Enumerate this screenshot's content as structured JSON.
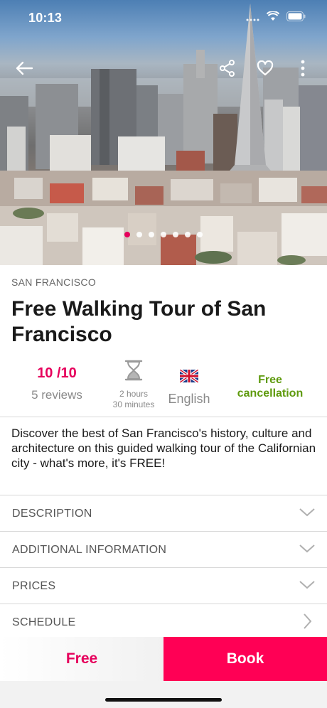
{
  "status_bar": {
    "time": "10:13"
  },
  "hero": {
    "image": "San Francisco skyline with Transamerica Pyramid",
    "carousel_count": 7,
    "carousel_active_index": 0,
    "nav_icons": [
      "back-arrow-icon",
      "share-icon",
      "heart-icon",
      "more-vertical-icon"
    ]
  },
  "tour": {
    "city": "SAN FRANCISCO",
    "title": "Free Walking Tour of San Francisco",
    "rating": "10 /10",
    "reviews": "5 reviews",
    "duration_line1": "2 hours",
    "duration_line2": "30 minutes",
    "language": "English",
    "cancellation": "Free cancellation",
    "description": "Discover the best of San Francisco's history, culture and architecture on this guided walking tour of the Californian city - what's more, it's FREE!"
  },
  "sections": [
    {
      "label": "DESCRIPTION",
      "icon": "chevron-down-icon"
    },
    {
      "label": "ADDITIONAL INFORMATION",
      "icon": "chevron-down-icon"
    },
    {
      "label": "PRICES",
      "icon": "chevron-down-icon"
    },
    {
      "label": "SCHEDULE",
      "icon": "chevron-right-icon"
    }
  ],
  "bottom_bar": {
    "price_label": "Free",
    "book_label": "Book"
  },
  "colors": {
    "accent": "#e6005c",
    "book_button": "#ff0055",
    "cancellation": "#5e9a0d"
  }
}
